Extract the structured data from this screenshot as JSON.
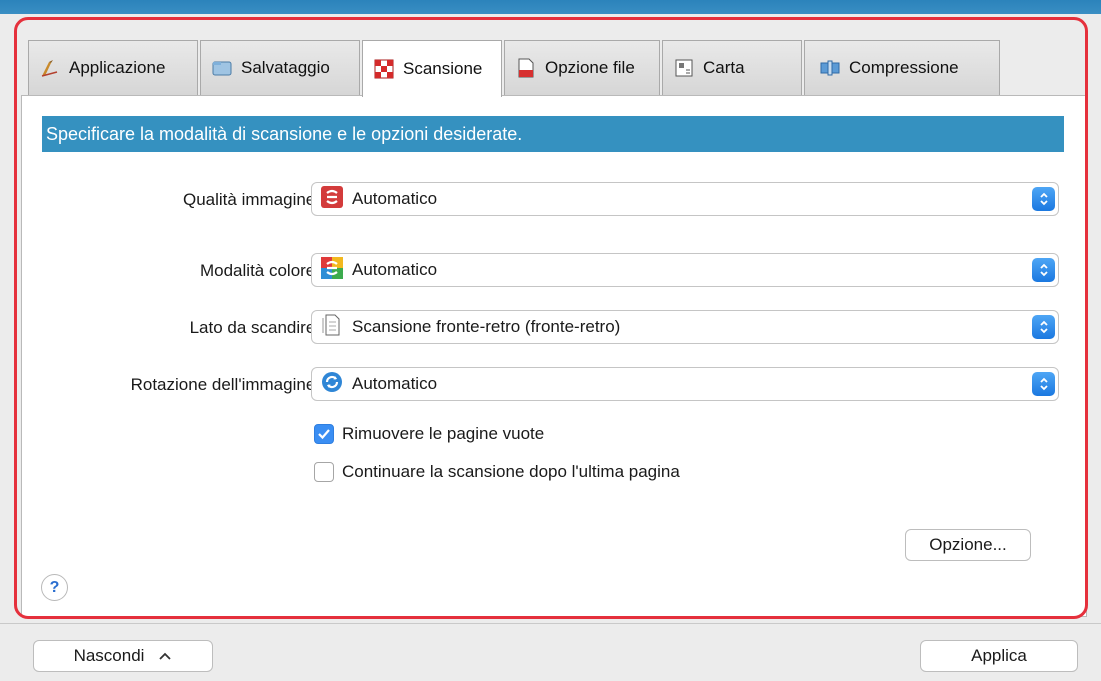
{
  "tabs": [
    {
      "label": "Applicazione",
      "icon": "pen-icon"
    },
    {
      "label": "Salvataggio",
      "icon": "folder-icon"
    },
    {
      "label": "Scansione",
      "icon": "scan-checker-icon",
      "active": true
    },
    {
      "label": "Opzione file",
      "icon": "file-icon"
    },
    {
      "label": "Carta",
      "icon": "paper-icon"
    },
    {
      "label": "Compressione",
      "icon": "compression-icon"
    }
  ],
  "header": {
    "text": "Specificare la modalità di scansione e le opzioni desiderate."
  },
  "settings": [
    {
      "label": "Qualità immagine:",
      "value": "Automatico",
      "icon": "image-quality-icon"
    },
    {
      "label": "Modalità colore:",
      "value": "Automatico",
      "icon": "color-mode-icon"
    },
    {
      "label": "Lato da scandire:",
      "value": "Scansione fronte-retro (fronte-retro)",
      "icon": "duplex-page-icon"
    },
    {
      "label": "Rotazione dell'immagine:",
      "value": "Automatico",
      "icon": "rotate-icon"
    }
  ],
  "checkboxes": [
    {
      "label": "Rimuovere le pagine vuote",
      "checked": true
    },
    {
      "label": "Continuare la scansione dopo l'ultima pagina",
      "checked": false
    }
  ],
  "buttons": {
    "option": "Opzione...",
    "help": "?",
    "hide": "Nascondi",
    "apply": "Applica"
  },
  "colors": {
    "accent": "#3591c0",
    "highlight_border": "#e5303c",
    "checkbox_checked": "#3a8ef3"
  }
}
